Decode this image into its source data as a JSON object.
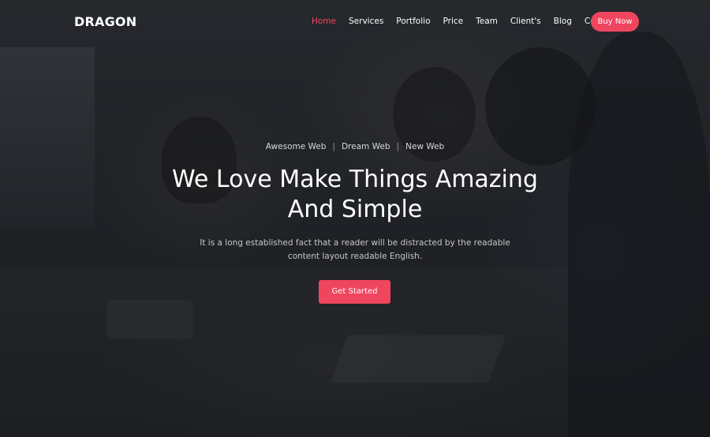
{
  "brand": {
    "logo_text": "DRAGON",
    "accent_color": "#f0455f"
  },
  "nav": {
    "items": [
      {
        "label": "Home",
        "active": true
      },
      {
        "label": "Services",
        "active": false
      },
      {
        "label": "Portfolio",
        "active": false
      },
      {
        "label": "Price",
        "active": false
      },
      {
        "label": "Team",
        "active": false
      },
      {
        "label": "Client's",
        "active": false
      },
      {
        "label": "Blog",
        "active": false
      },
      {
        "label": "Contact",
        "active": false
      }
    ],
    "buy_button_label": "Buy Now"
  },
  "hero": {
    "taglines": [
      "Awesome Web",
      "Dream Web",
      "New Web"
    ],
    "headline_line1": "We Love Make Things Amazing",
    "headline_line2": "And Simple",
    "description_line1": "It is a long established fact that a reader will be distracted by the readable",
    "description_line2": "content layout readable English.",
    "cta_label": "Get Started"
  }
}
